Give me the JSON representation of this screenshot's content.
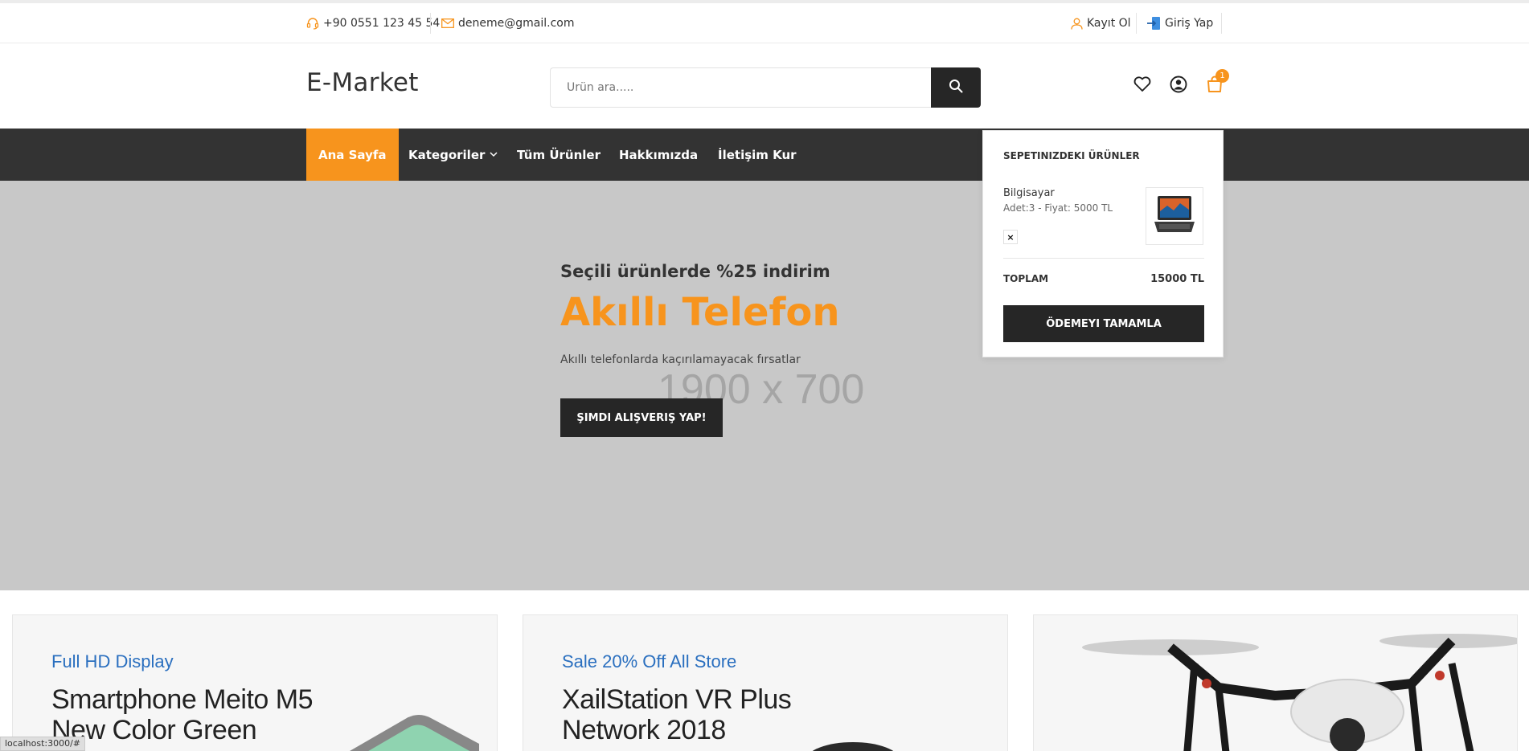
{
  "topbar": {
    "phone": "+90 0551 123 45 54",
    "email": "deneme@gmail.com",
    "register": "Kayıt Ol",
    "login": "Giriş Yap"
  },
  "header": {
    "logo": "E-Market",
    "search_placeholder": "Ürün ara.....",
    "cart_count": "1"
  },
  "nav": {
    "items": [
      {
        "label": "Ana Sayfa"
      },
      {
        "label": "Kategoriler"
      },
      {
        "label": "Tüm Ürünler"
      },
      {
        "label": "Hakkımızda"
      },
      {
        "label": "İletişim Kur"
      }
    ]
  },
  "hero": {
    "subtitle": "Seçili ürünlerde %25 indirim",
    "title": "Akıllı Telefon",
    "description": "Akıllı telefonlarda kaçırılamayacak fırsatlar",
    "button": "ŞIMDI ALIŞVERIŞ YAP!",
    "placeholder": "1900 x 700"
  },
  "cart_dropdown": {
    "title": "SEPETINIZDEKI ÜRÜNLER",
    "item_name": "Bilgisayar",
    "item_meta": "Adet:3 - Fiyat: 5000 TL",
    "remove": "×",
    "total_label": "TOPLAM",
    "total_value": "15000 TL",
    "checkout": "ÖDEMEYI TAMAMLA"
  },
  "banners": [
    {
      "small": "Full HD Display",
      "big_line1": "Smartphone Meito M5",
      "big_line2": "New Color Green"
    },
    {
      "small": "Sale 20% Off All Store",
      "big_line1": "XailStation VR Plus",
      "big_line2": "Network 2018"
    }
  ],
  "status_bar": {
    "url": "localhost:3000/#"
  },
  "colors": {
    "accent": "#f7941d",
    "dark": "#262626",
    "nav": "#333333",
    "hero_bg": "#c8c8c8"
  }
}
